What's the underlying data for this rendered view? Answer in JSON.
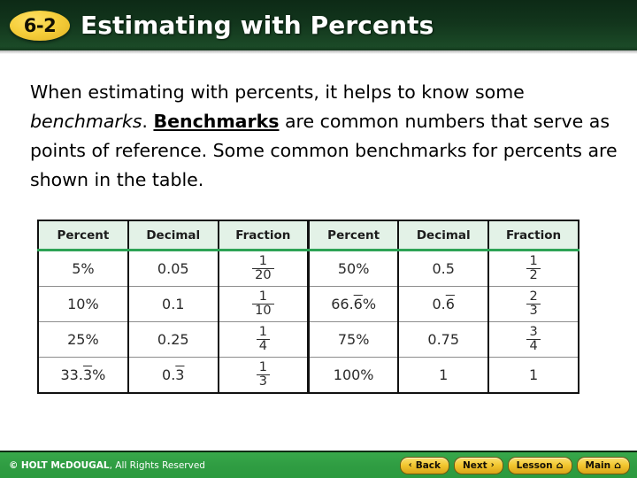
{
  "header": {
    "lesson_number": "6-2",
    "title": "Estimating with Percents"
  },
  "body": {
    "text_part1": "When estimating with percents, it helps to know some ",
    "text_italic": "benchmarks",
    "text_part2": ". ",
    "text_bold": "Benchmarks",
    "text_part3": " are common numbers that serve as points of reference. Some common benchmarks for percents are shown in the table."
  },
  "table": {
    "headers": [
      "Percent",
      "Decimal",
      "Fraction",
      "Percent",
      "Decimal",
      "Fraction"
    ],
    "rows": [
      {
        "left_percent": "5%",
        "left_decimal": "0.05",
        "left_fraction_num": "1",
        "left_fraction_den": "20",
        "right_percent": "50%",
        "right_decimal": "0.5",
        "right_fraction_num": "1",
        "right_fraction_den": "2"
      },
      {
        "left_percent": "10%",
        "left_decimal": "0.1",
        "left_fraction_num": "1",
        "left_fraction_den": "10",
        "right_percent_pre": "66.",
        "right_percent_bar": "6",
        "right_percent_post": "%",
        "right_decimal_pre": "0.",
        "right_decimal_bar": "6",
        "right_fraction_num": "2",
        "right_fraction_den": "3"
      },
      {
        "left_percent": "25%",
        "left_decimal": "0.25",
        "left_fraction_num": "1",
        "left_fraction_den": "4",
        "right_percent": "75%",
        "right_decimal": "0.75",
        "right_fraction_num": "3",
        "right_fraction_den": "4"
      },
      {
        "left_percent_pre": "33.",
        "left_percent_bar": "3",
        "left_percent_post": "%",
        "left_decimal_pre": "0.",
        "left_decimal_bar": "3",
        "left_fraction_num": "1",
        "left_fraction_den": "3",
        "right_percent": "100%",
        "right_decimal": "1",
        "right_fraction_whole": "1"
      }
    ]
  },
  "footer": {
    "copyright_symbol": "©",
    "copyright_brand": "HOLT McDOUGAL",
    "copyright_rest": ", All Rights Reserved",
    "buttons": [
      {
        "label": "Back",
        "glyph": "‹",
        "icon": "chevron-left-icon"
      },
      {
        "label": "Next",
        "glyph": "›",
        "icon": "chevron-right-icon"
      },
      {
        "label": "Lesson",
        "glyph": "⌂",
        "icon": "home-icon"
      },
      {
        "label": "Main",
        "glyph": "⌂",
        "icon": "home-icon"
      }
    ]
  },
  "colors": {
    "header_green": "#12351c",
    "badge_gold": "#f2c62f",
    "footer_green": "#2f9c42",
    "table_header_mint": "#e3f2e7",
    "table_header_rule": "#2da355"
  }
}
